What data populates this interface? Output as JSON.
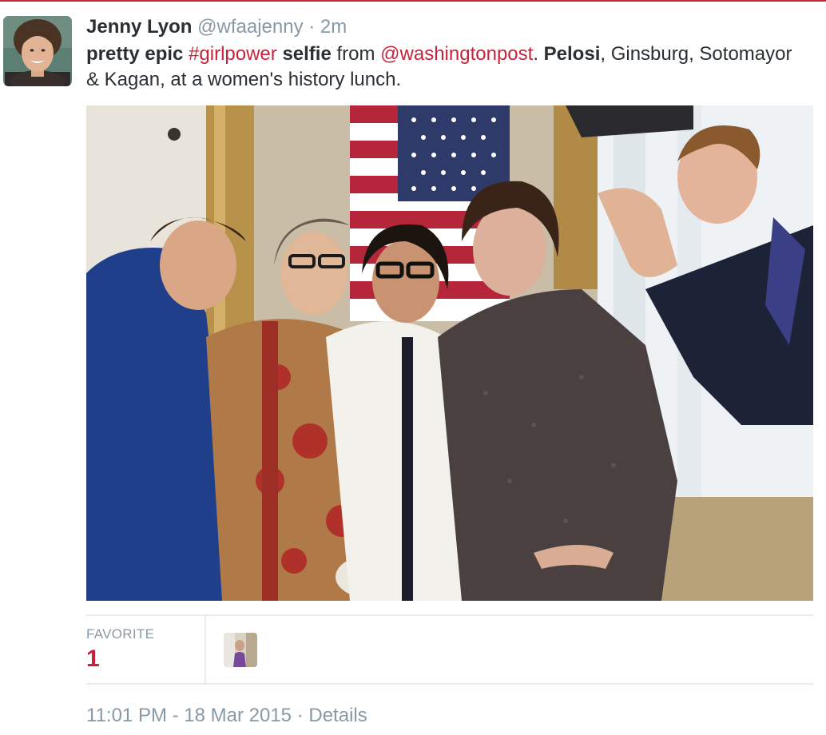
{
  "tweet": {
    "author_name": "Jenny Lyon",
    "handle": "@wfaajenny",
    "separator": "·",
    "time_ago": "2m",
    "text": {
      "pretty_epic": "pretty epic",
      "hashtag": "#girlpower",
      "selfie": "selfie",
      "from": "from",
      "mention": "@washingtonpost",
      "period": ".",
      "pelosi": "Pelosi",
      "rest": ", Ginsburg, Sotomayor & Kagan, at a women's history lunch."
    },
    "media": {
      "photo_icon": "embedded-photo"
    }
  },
  "stats": {
    "favorite_label": "FAVORITE",
    "favorite_count": "1"
  },
  "footer": {
    "timestamp": "11:01 PM - 18 Mar 2015",
    "separator": "·",
    "details_link": "Details"
  },
  "colors": {
    "accent": "#c6233c",
    "muted": "#8899a6",
    "text": "#292f33",
    "border": "#e6ecf0"
  }
}
